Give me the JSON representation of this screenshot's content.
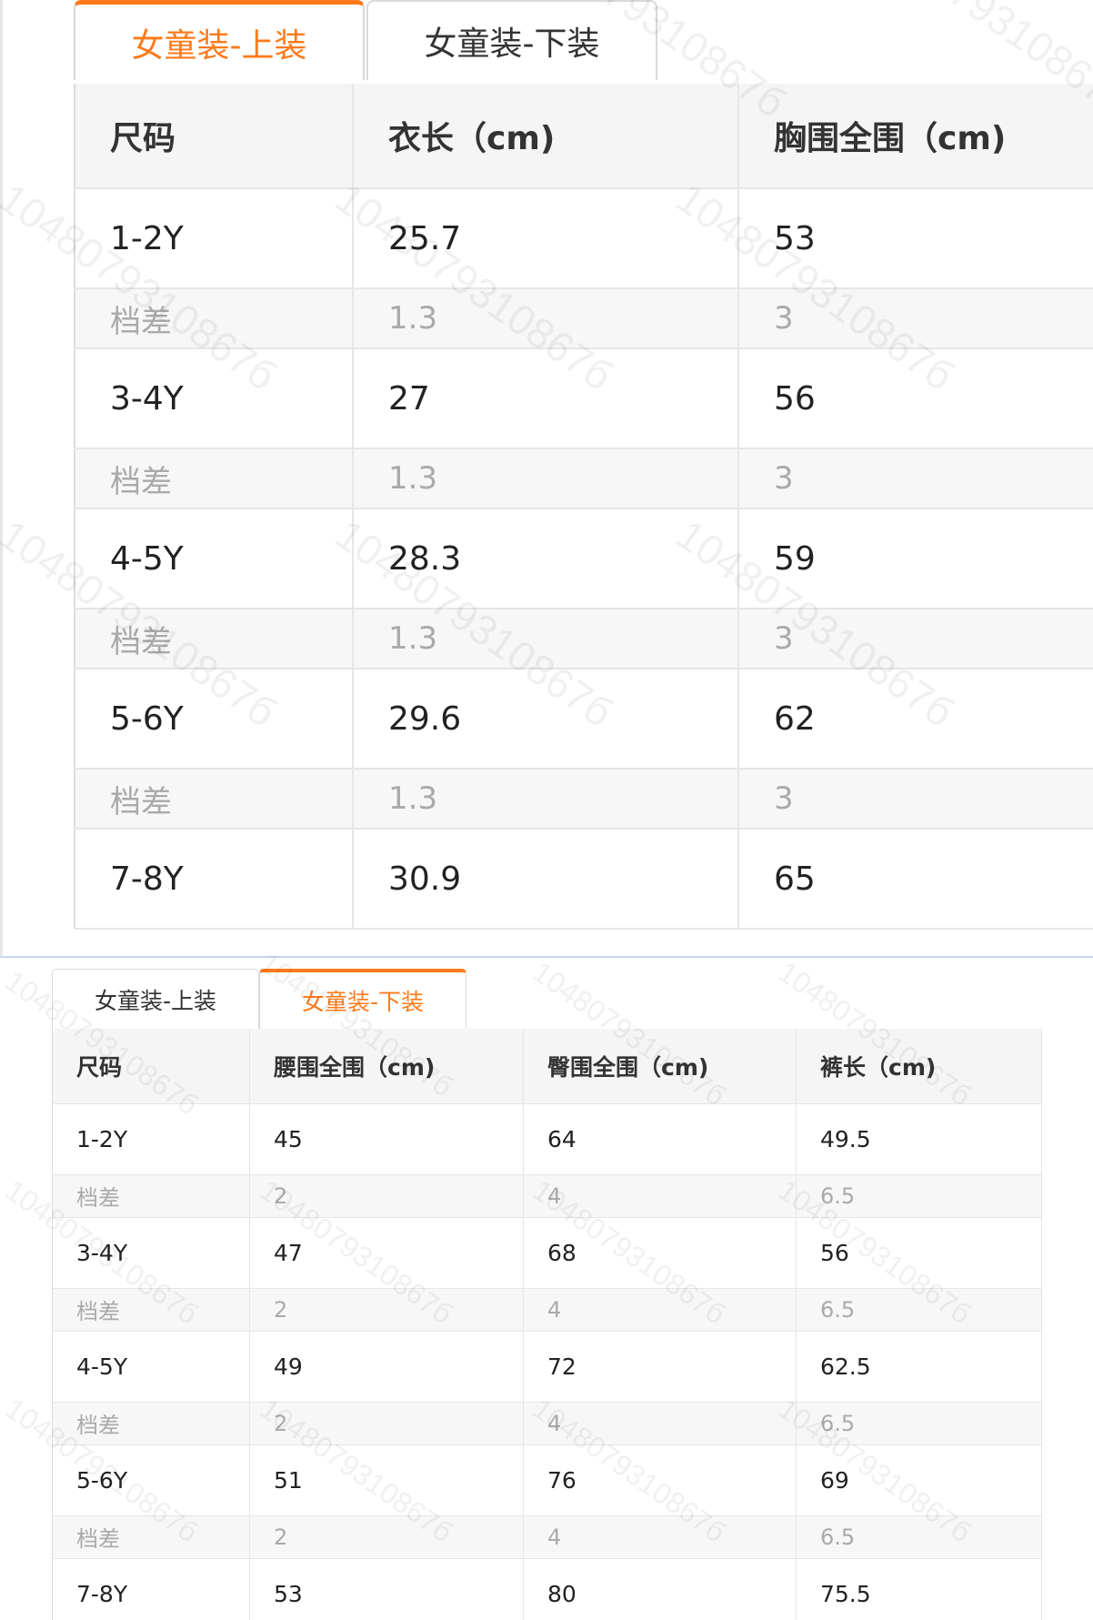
{
  "top_panel": {
    "tabs": [
      {
        "label": "女童装-上装",
        "active": true
      },
      {
        "label": "女童装-下装",
        "active": false
      }
    ],
    "headers": [
      "尺码",
      "衣长（cm)",
      "胸围全围（cm)"
    ],
    "rows": [
      {
        "type": "main",
        "cells": [
          "1-2Y",
          "25.7",
          "53"
        ]
      },
      {
        "type": "diff",
        "cells": [
          "档差",
          "1.3",
          "3"
        ]
      },
      {
        "type": "main",
        "cells": [
          "3-4Y",
          "27",
          "56"
        ]
      },
      {
        "type": "diff",
        "cells": [
          "档差",
          "1.3",
          "3"
        ]
      },
      {
        "type": "main",
        "cells": [
          "4-5Y",
          "28.3",
          "59"
        ]
      },
      {
        "type": "diff",
        "cells": [
          "档差",
          "1.3",
          "3"
        ]
      },
      {
        "type": "main",
        "cells": [
          "5-6Y",
          "29.6",
          "62"
        ]
      },
      {
        "type": "diff",
        "cells": [
          "档差",
          "1.3",
          "3"
        ]
      },
      {
        "type": "main",
        "cells": [
          "7-8Y",
          "30.9",
          "65"
        ]
      }
    ]
  },
  "bottom_panel": {
    "tabs": [
      {
        "label": "女童装-上装",
        "active": false
      },
      {
        "label": "女童装-下装",
        "active": true
      }
    ],
    "headers": [
      "尺码",
      "腰围全围（cm)",
      "臀围全围（cm)",
      "裤长（cm)"
    ],
    "rows": [
      {
        "type": "main",
        "cells": [
          "1-2Y",
          "45",
          "64",
          "49.5"
        ]
      },
      {
        "type": "diff",
        "cells": [
          "档差",
          "2",
          "4",
          "6.5"
        ]
      },
      {
        "type": "main",
        "cells": [
          "3-4Y",
          "47",
          "68",
          "56"
        ]
      },
      {
        "type": "diff",
        "cells": [
          "档差",
          "2",
          "4",
          "6.5"
        ]
      },
      {
        "type": "main",
        "cells": [
          "4-5Y",
          "49",
          "72",
          "62.5"
        ]
      },
      {
        "type": "diff",
        "cells": [
          "档差",
          "2",
          "4",
          "6.5"
        ]
      },
      {
        "type": "main",
        "cells": [
          "5-6Y",
          "51",
          "76",
          "69"
        ]
      },
      {
        "type": "diff",
        "cells": [
          "档差",
          "2",
          "4",
          "6.5"
        ]
      },
      {
        "type": "main",
        "cells": [
          "7-8Y",
          "53",
          "80",
          "75.5"
        ]
      }
    ]
  },
  "watermark": "1048079310867б",
  "colors": {
    "accent": "#ff7a1a",
    "header_bg": "#f5f5f5",
    "diff_bg": "#f7f7f7",
    "diff_text": "#aaaaaa"
  }
}
